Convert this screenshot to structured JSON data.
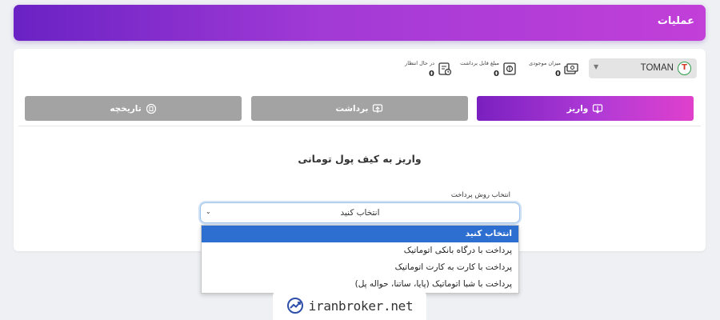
{
  "header": {
    "title": "عملیات"
  },
  "balance": {
    "currency": {
      "name": "TOMAN",
      "logo_letter": "T"
    },
    "stats": [
      {
        "label": "میزان موجودی",
        "value": "0",
        "icon": "cash-icon"
      },
      {
        "label": "مبلغ قابل برداشت",
        "value": "0",
        "icon": "wallet-icon"
      },
      {
        "label": "در حال انتظار",
        "value": "0",
        "icon": "pending-icon"
      }
    ]
  },
  "tabs": [
    {
      "label": "واریز",
      "icon": "deposit-icon",
      "active": true
    },
    {
      "label": "برداشت",
      "icon": "withdraw-icon",
      "active": false
    },
    {
      "label": "تاریخچه",
      "icon": "history-icon",
      "active": false
    }
  ],
  "deposit": {
    "title": "واریز به کیف پول تومانی",
    "method_label": "انتخاب روش پرداخت",
    "selected_value": "انتخاب کنید",
    "options": [
      "انتخاب کنید",
      "پرداخت با درگاه بانکی اتوماتیک",
      "پرداخت با کارت به کارت اتوماتیک",
      "پرداخت با شبا اتوماتیک (پایا، ساتنا، حواله پل)"
    ]
  },
  "watermark": {
    "text": "iranbroker.net"
  },
  "colors": {
    "accent": "#a23ad6",
    "inactive": "#a3a3a3",
    "highlight": "#2c6fd1"
  }
}
